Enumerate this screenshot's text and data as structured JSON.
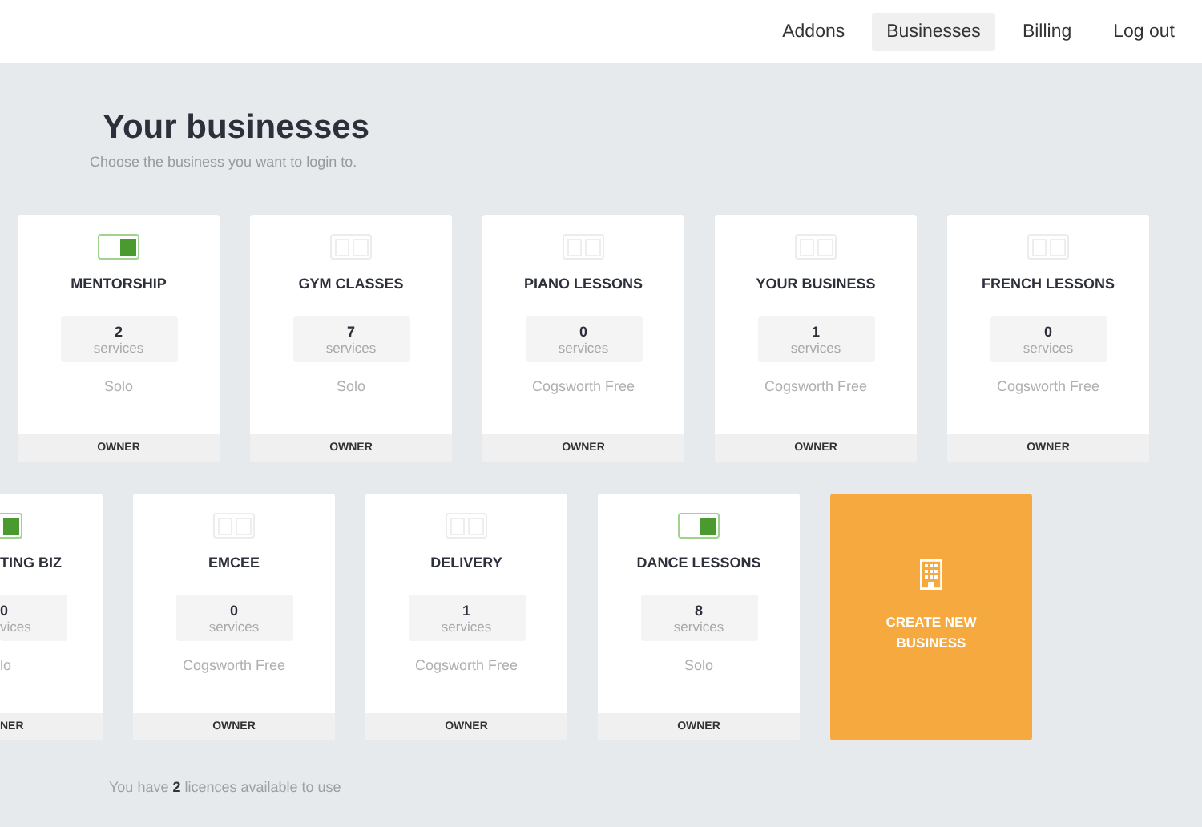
{
  "nav": [
    {
      "label": "Addons",
      "selected": false
    },
    {
      "label": "Businesses",
      "selected": true
    },
    {
      "label": "Billing",
      "selected": false
    },
    {
      "label": "Log out",
      "selected": false
    }
  ],
  "title": "Your businesses",
  "subtitle": "Choose the business you want to login to.",
  "rows": [
    [
      {
        "kind": "card",
        "name": "MENTORSHIP",
        "on": true,
        "count": "2",
        "unit": "services",
        "plan": "Solo",
        "role": "OWNER"
      },
      {
        "kind": "card",
        "name": "GYM CLASSES",
        "on": false,
        "count": "7",
        "unit": "services",
        "plan": "Solo",
        "role": "OWNER"
      },
      {
        "kind": "card",
        "name": "PIANO LESSONS",
        "on": false,
        "count": "0",
        "unit": "services",
        "plan": "Cogsworth Free",
        "role": "OWNER"
      },
      {
        "kind": "card",
        "name": "YOUR BUSINESS",
        "on": false,
        "count": "1",
        "unit": "services",
        "plan": "Cogsworth Free",
        "role": "OWNER"
      },
      {
        "kind": "card",
        "name": "FRENCH LESSONS",
        "on": false,
        "count": "0",
        "unit": "services",
        "plan": "Cogsworth Free",
        "role": "OWNER"
      }
    ],
    [
      {
        "kind": "partial",
        "name": "TING BIZ",
        "on": true,
        "count": "0",
        "unit": "vices",
        "plan": "lo",
        "role": "NER"
      },
      {
        "kind": "card",
        "name": "EMCEE",
        "on": false,
        "count": "0",
        "unit": "services",
        "plan": "Cogsworth Free",
        "role": "OWNER"
      },
      {
        "kind": "card",
        "name": "DELIVERY",
        "on": false,
        "count": "1",
        "unit": "services",
        "plan": "Cogsworth Free",
        "role": "OWNER"
      },
      {
        "kind": "card",
        "name": "DANCE LESSONS",
        "on": true,
        "count": "8",
        "unit": "services",
        "plan": "Solo",
        "role": "OWNER"
      },
      {
        "kind": "create",
        "name": "CREATE NEW BUSINESS"
      }
    ]
  ],
  "footer": "You have **2** licences available to use"
}
